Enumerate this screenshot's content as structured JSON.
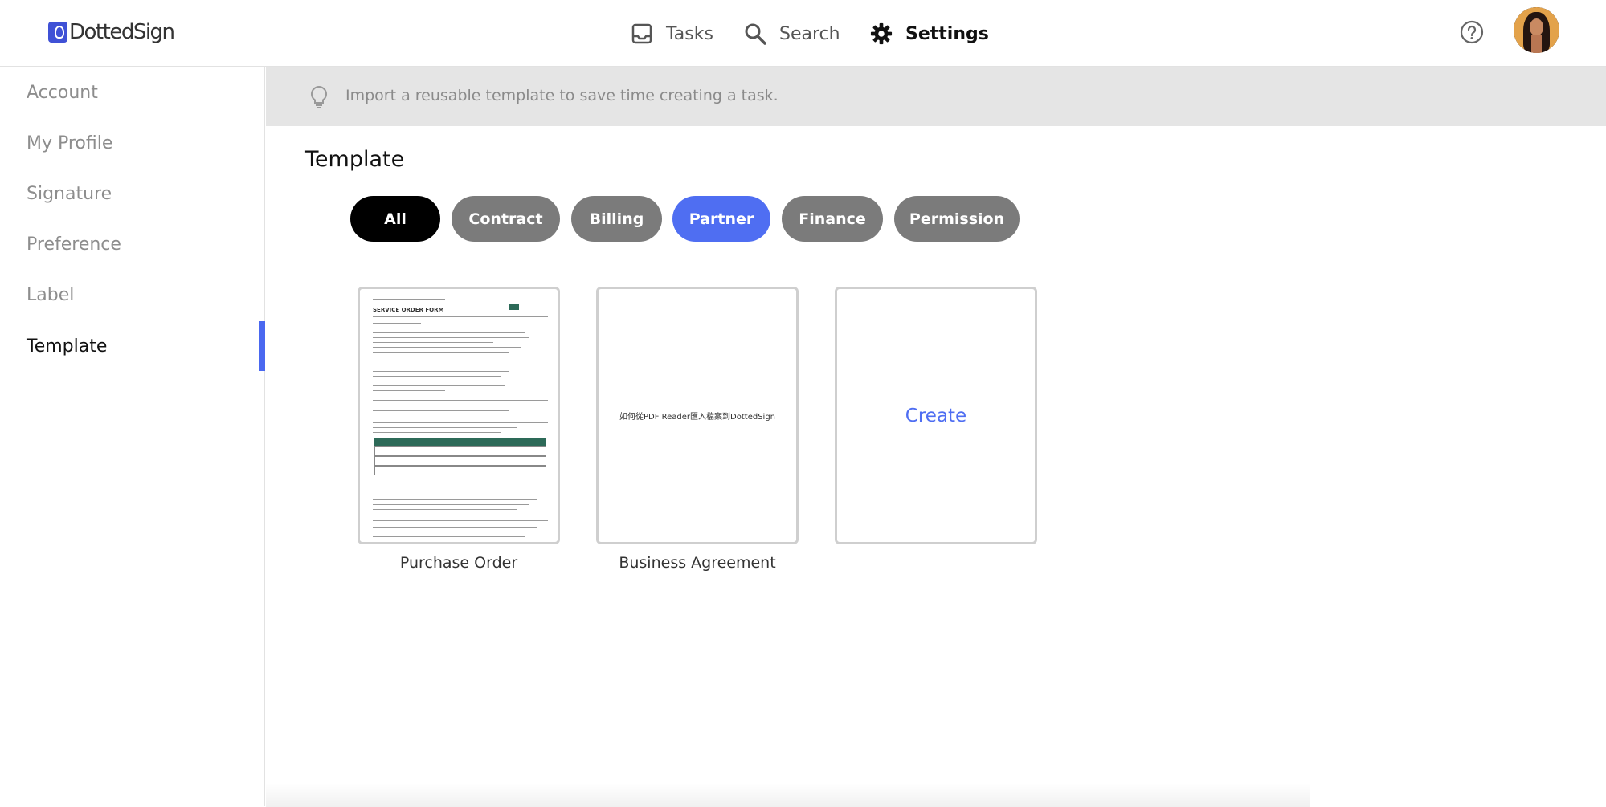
{
  "app": {
    "logo_text": "DottedSign"
  },
  "nav": {
    "tasks_label": "Tasks",
    "search_label": "Search",
    "settings_label": "Settings"
  },
  "sidebar": {
    "items": [
      {
        "label": "Account"
      },
      {
        "label": "My Profile"
      },
      {
        "label": "Signature"
      },
      {
        "label": "Preference"
      },
      {
        "label": "Label"
      },
      {
        "label": "Template"
      }
    ],
    "active": "Template"
  },
  "tip": {
    "text": "Import a reusable template to save time creating a task."
  },
  "main": {
    "title": "Template",
    "filters": [
      {
        "label": "All"
      },
      {
        "label": "Contract"
      },
      {
        "label": "Billing"
      },
      {
        "label": "Partner"
      },
      {
        "label": "Finance"
      },
      {
        "label": "Permission"
      }
    ],
    "active_filter": "Partner",
    "templates": [
      {
        "name": "Purchase Order",
        "preview_heading": "SERVICE ORDER FORM"
      },
      {
        "name": "Business Agreement",
        "preview_text": "如何從PDF Reader匯入檔案到DottedSign"
      }
    ],
    "create_label": "Create"
  },
  "colors": {
    "accent": "#4f6ef2",
    "chip_default": "#7b7b7b",
    "chip_all": "#000000",
    "tip_bg": "#e5e5e5"
  }
}
